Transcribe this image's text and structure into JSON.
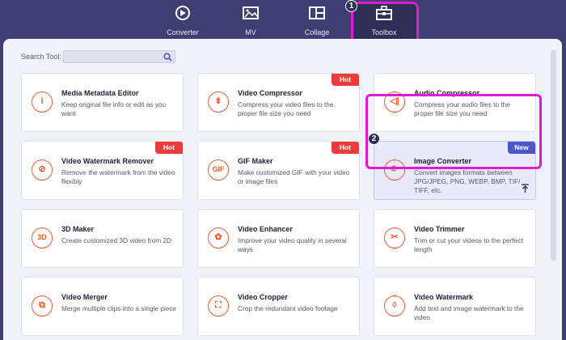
{
  "nav": {
    "items": [
      {
        "label": "Converter",
        "icon": "converter-icon"
      },
      {
        "label": "MV",
        "icon": "mv-icon"
      },
      {
        "label": "Collage",
        "icon": "collage-icon"
      },
      {
        "label": "Toolbox",
        "icon": "toolbox-icon",
        "active": true
      }
    ]
  },
  "steps": {
    "one": "1",
    "two": "2"
  },
  "search": {
    "label": "Search Tool:",
    "value": ""
  },
  "cards": [
    {
      "title": "Media Metadata Editor",
      "desc": "Keep original file info or edit as you want",
      "icon_glyph": "i",
      "tag": ""
    },
    {
      "title": "Video Compressor",
      "desc": "Compress your video files to the proper file size you need",
      "icon_glyph": "⇟",
      "tag": "Hot"
    },
    {
      "title": "Audio Compressor",
      "desc": "Compress your audio files to the proper file size you need",
      "icon_glyph": "◁|",
      "tag": ""
    },
    {
      "title": "Video Watermark Remover",
      "desc": "Remove the watermark from the video flexibly",
      "icon_glyph": "⊘",
      "tag": "Hot"
    },
    {
      "title": "GIF Maker",
      "desc": "Make customized GIF with your video or image files",
      "icon_glyph": "GIF",
      "tag": "Hot"
    },
    {
      "title": "Image Converter",
      "desc": "Convert images formats between JPG/JPEG, PNG, WEBP, BMP, TIF/ TIFF, etc.",
      "icon_glyph": "⟳",
      "tag": "New"
    },
    {
      "title": "3D Maker",
      "desc": "Create customized 3D video from 2D",
      "icon_glyph": "3D",
      "tag": ""
    },
    {
      "title": "Video Enhancer",
      "desc": "Improve your video quality in several ways",
      "icon_glyph": "✿",
      "tag": ""
    },
    {
      "title": "Video Trimmer",
      "desc": "Trim or cut your videos to the perfect length",
      "icon_glyph": "✂",
      "tag": ""
    },
    {
      "title": "Video Merger",
      "desc": "Merge multiple clips into a single piece",
      "icon_glyph": "⧉",
      "tag": ""
    },
    {
      "title": "Video Cropper",
      "desc": "Crop the redundant video footage",
      "icon_glyph": "⛶",
      "tag": ""
    },
    {
      "title": "Video Watermark",
      "desc": "Add text and image watermark to the video",
      "icon_glyph": "◊",
      "tag": ""
    }
  ],
  "colors": {
    "accent": "#f05a28",
    "highlight": "#e11ad6",
    "hot": "#ec3b3b",
    "new": "#4d55c8",
    "nav_bg": "#3d3f72"
  }
}
